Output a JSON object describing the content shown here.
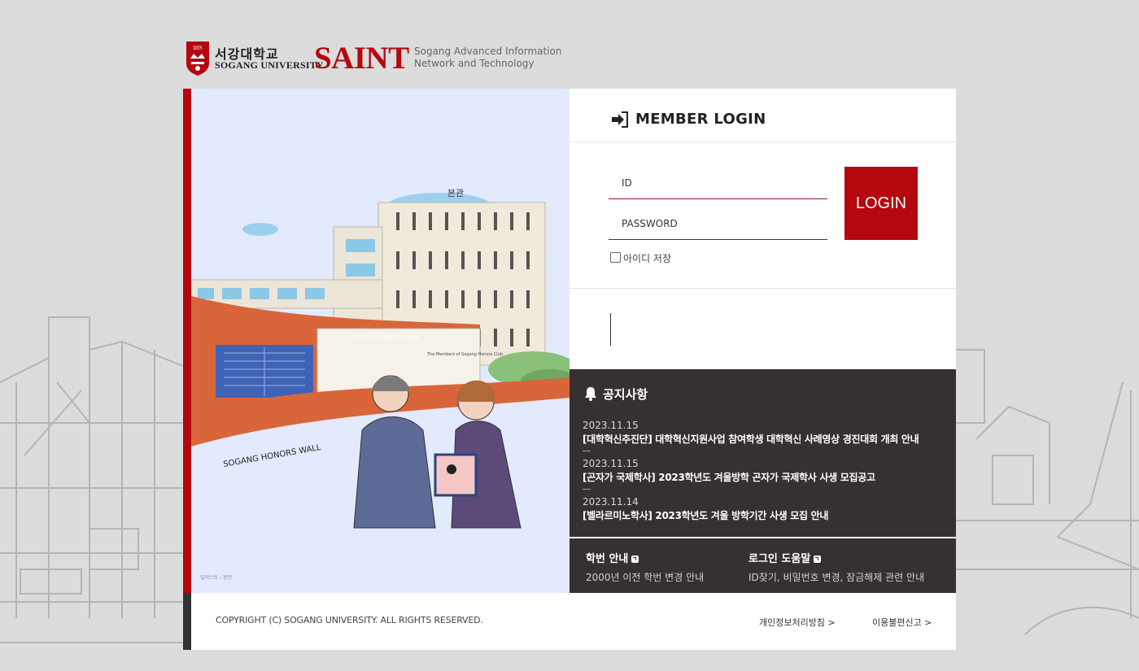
{
  "header": {
    "logo_ko": "서강대학교",
    "logo_en": "SOGANG UNIVERSITY",
    "seal_text": "IHS",
    "brand": "SAINT",
    "brand_desc_line1": "Sogang Advanced Information",
    "brand_desc_line2": "Network and Technology"
  },
  "illustration": {
    "building_label": "본관",
    "club_label": "SOGANG HONORS CLUB",
    "wall_label": "SOGANG HONORS WALL",
    "plaque_title": "The Members of Sogang Honors Club",
    "credit": "일러스트 - 정민"
  },
  "login": {
    "title": "MEMBER LOGIN",
    "id_placeholder": "ID",
    "password_placeholder": "PASSWORD",
    "login_button": "LOGIN",
    "save_id_label": "아이디 저장"
  },
  "notice": {
    "title": "공지사항",
    "items": [
      {
        "date": "2023.11.15",
        "text": "[대학혁신추진단] 대학혁신지원사업 참여학생 대학혁신 사례영상 경진대회 개최 안내"
      },
      {
        "date": "2023.11.15",
        "text": "[곤자가 국제학사] 2023학년도 겨울방학 곤자가 국제학사 사생 모집공고"
      },
      {
        "date": "2023.11.14",
        "text": "[벨라르미노학사] 2023학년도 겨울 방학기간 사생 모집 안내"
      }
    ]
  },
  "quick_links": [
    {
      "title": "학번 안내",
      "sub": "2000년 이전 학번 변경 안내"
    },
    {
      "title": "로그인 도움말",
      "sub": "ID찾기, 비밀번호 변경, 잠금해제 관련 안내"
    }
  ],
  "footer": {
    "copyright": "COPYRIGHT (C) SOGANG UNIVERSITY. ALL RIGHTS RESERVED.",
    "privacy": "개인정보처리방침 >",
    "report": "이용불편신고 >"
  },
  "colors": {
    "brand_red": "#b5070e",
    "dark_panel": "#363031",
    "page_bg": "#dcdcdc",
    "illustration_bg": "#e3eafd"
  }
}
